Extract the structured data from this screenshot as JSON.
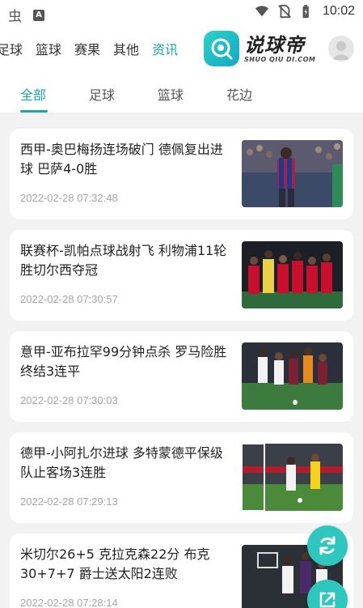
{
  "status_bar": {
    "time": "10:02",
    "icons": [
      "bug-icon",
      "accessibility-a-icon",
      "wifi-icon",
      "no-sim-icon",
      "battery-icon"
    ]
  },
  "top_nav": {
    "items": [
      {
        "label": "足球",
        "active": false
      },
      {
        "label": "篮球",
        "active": false
      },
      {
        "label": "赛果",
        "active": false
      },
      {
        "label": "其他",
        "active": false
      },
      {
        "label": "资讯",
        "active": true
      }
    ],
    "logo": {
      "cn": "说球帝",
      "en": "SHUO QIU DI.COM"
    },
    "accent": "#1aa8a0"
  },
  "sub_tabs": [
    {
      "label": "全部",
      "active": true
    },
    {
      "label": "足球",
      "active": false
    },
    {
      "label": "篮球",
      "active": false
    },
    {
      "label": "花边",
      "active": false
    }
  ],
  "news": [
    {
      "title": "西甲-奥巴梅扬连场破门 德佩复出进球 巴萨4-0胜",
      "time": "2022-02-28 07:32:48"
    },
    {
      "title": "联赛杯-凯帕点球战射飞 利物浦11轮胜切尔西夺冠",
      "time": "2022-02-28 07:30:57"
    },
    {
      "title": "意甲-亚布拉罕99分钟点杀 罗马险胜终结3连平",
      "time": "2022-02-28 07:30:03"
    },
    {
      "title": "德甲-小阿扎尔进球 多特蒙德平保级队止客场3连胜",
      "time": "2022-02-28 07:29:13"
    },
    {
      "title": "米切尔26+5 克拉克森22分 布克30+7+7 爵士送太阳2连败",
      "time": "2022-02-28 07:28:14"
    }
  ],
  "fabs": [
    "refresh-icon",
    "share-icon"
  ]
}
